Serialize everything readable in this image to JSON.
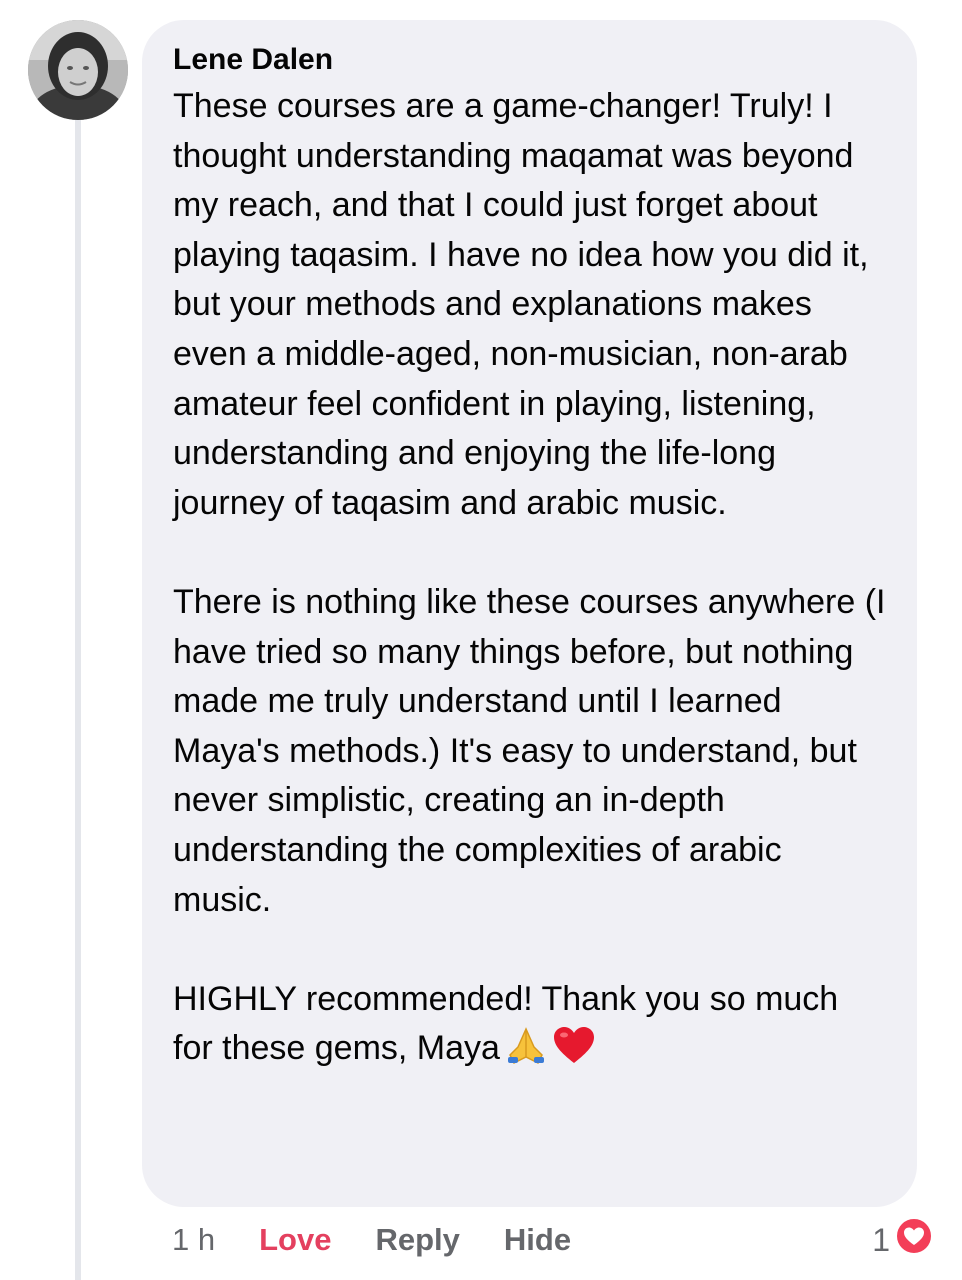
{
  "comment": {
    "author": "Lene Dalen",
    "paragraphs": [
      "These courses are a game-changer! Truly! I thought understanding maqamat was beyond my reach, and that I could just forget about playing taqasim. I have no idea how you did it, but your methods and explanations makes even a middle-aged, non-musician, non-arab amateur feel confident in playing, listening, understanding and enjoying the life-long journey of taqasim and arabic music.",
      "There is nothing like these courses anywhere (I have tried so many things before, but nothing made me truly understand until I learned Maya's methods.) It's easy to understand, but never simplistic, creating an in-depth understanding the complexities of arabic music.",
      "HIGHLY recommended! Thank you so much for these gems, Maya"
    ],
    "trailing_emojis": [
      "folded-hands-icon",
      "red-heart-icon"
    ]
  },
  "actions": {
    "time": "1 h",
    "love_label": "Love",
    "reply_label": "Reply",
    "hide_label": "Hide"
  },
  "reactions": {
    "count": "1",
    "icon": "love-reaction-icon"
  },
  "colors": {
    "bubble": "#f0f0f5",
    "love_active": "#e4405f",
    "muted_text": "#65676b"
  }
}
